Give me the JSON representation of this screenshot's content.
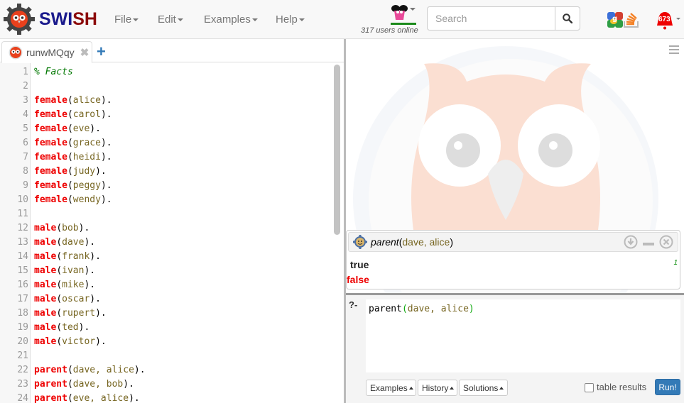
{
  "navbar": {
    "brand": {
      "sw": "SW",
      "i": "I",
      "sh": "SH"
    },
    "menus": [
      {
        "label": "File"
      },
      {
        "label": "Edit"
      },
      {
        "label": "Examples"
      },
      {
        "label": "Help"
      }
    ],
    "users_online": "317 users online",
    "search": {
      "placeholder": "Search",
      "value": ""
    },
    "notification_count": "673",
    "icons": [
      "swish-logo-icon",
      "user-avatar-icon",
      "search-icon",
      "google-icon",
      "stackoverflow-icon",
      "bell-icon"
    ]
  },
  "editor": {
    "tab_label": "runwMQqy",
    "lines": [
      {
        "n": "1",
        "kind": "comment",
        "text": "% Facts"
      },
      {
        "n": "2",
        "kind": "blank"
      },
      {
        "n": "3",
        "kind": "fact",
        "pred": "female",
        "args": "alice"
      },
      {
        "n": "4",
        "kind": "fact",
        "pred": "female",
        "args": "carol"
      },
      {
        "n": "5",
        "kind": "fact",
        "pred": "female",
        "args": "eve"
      },
      {
        "n": "6",
        "kind": "fact",
        "pred": "female",
        "args": "grace"
      },
      {
        "n": "7",
        "kind": "fact",
        "pred": "female",
        "args": "heidi"
      },
      {
        "n": "8",
        "kind": "fact",
        "pred": "female",
        "args": "judy"
      },
      {
        "n": "9",
        "kind": "fact",
        "pred": "female",
        "args": "peggy"
      },
      {
        "n": "10",
        "kind": "fact",
        "pred": "female",
        "args": "wendy"
      },
      {
        "n": "11",
        "kind": "blank"
      },
      {
        "n": "12",
        "kind": "fact",
        "pred": "male",
        "args": "bob"
      },
      {
        "n": "13",
        "kind": "fact",
        "pred": "male",
        "args": "dave"
      },
      {
        "n": "14",
        "kind": "fact",
        "pred": "male",
        "args": "frank"
      },
      {
        "n": "15",
        "kind": "fact",
        "pred": "male",
        "args": "ivan"
      },
      {
        "n": "16",
        "kind": "fact",
        "pred": "male",
        "args": "mike"
      },
      {
        "n": "17",
        "kind": "fact",
        "pred": "male",
        "args": "oscar"
      },
      {
        "n": "18",
        "kind": "fact",
        "pred": "male",
        "args": "rupert"
      },
      {
        "n": "19",
        "kind": "fact",
        "pred": "male",
        "args": "ted"
      },
      {
        "n": "20",
        "kind": "fact",
        "pred": "male",
        "args": "victor"
      },
      {
        "n": "21",
        "kind": "blank"
      },
      {
        "n": "22",
        "kind": "fact",
        "pred": "parent",
        "args": "dave, alice"
      },
      {
        "n": "23",
        "kind": "fact",
        "pred": "parent",
        "args": "dave, bob"
      },
      {
        "n": "24",
        "kind": "fact",
        "pred": "parent",
        "args": "eve, alice"
      }
    ]
  },
  "runner": {
    "query_pred": "parent",
    "query_args": "dave, alice",
    "answers": [
      {
        "text": "true",
        "index": "1"
      },
      {
        "text": "false"
      }
    ]
  },
  "query": {
    "prompt": "?-",
    "text_pred": "parent",
    "text_args": "dave, alice",
    "buttons": [
      {
        "label": "Examples"
      },
      {
        "label": "History"
      },
      {
        "label": "Solutions"
      }
    ],
    "table_results_label": "table results",
    "table_results_checked": false,
    "run_label": "Run!"
  }
}
